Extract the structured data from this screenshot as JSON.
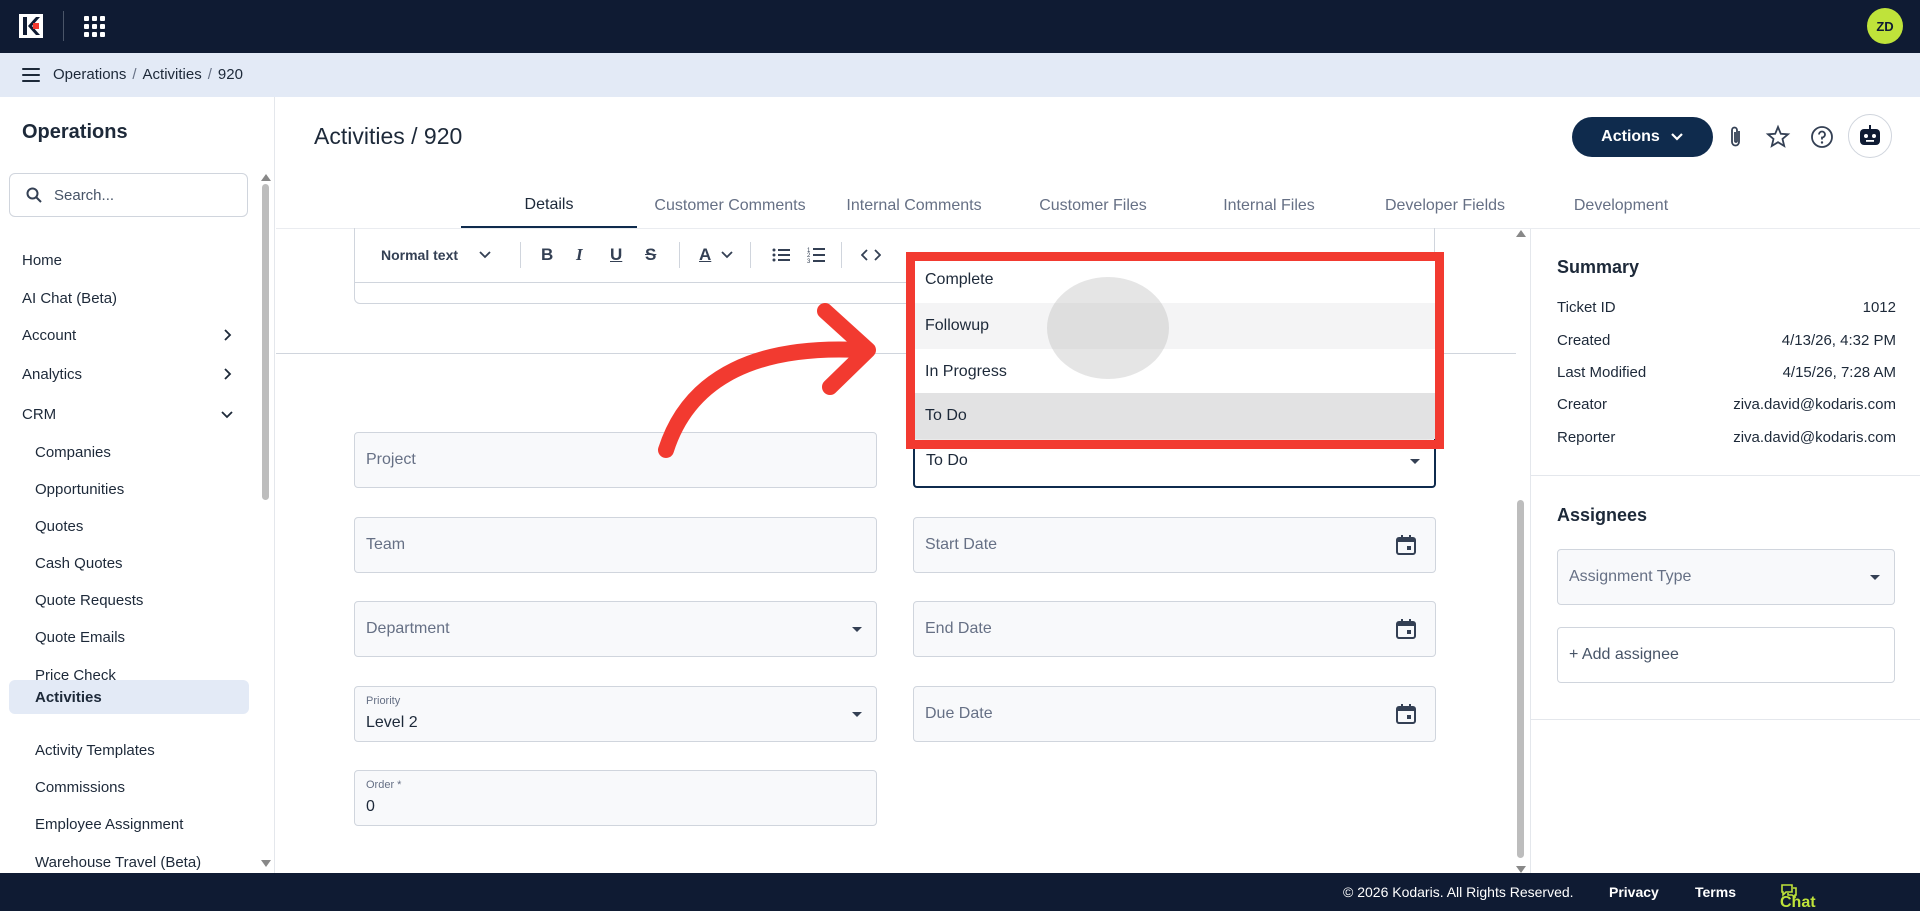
{
  "topbar": {
    "avatar_initials": "ZD"
  },
  "breadcrumb": {
    "items": [
      "Operations",
      "Activities",
      "920"
    ],
    "sep": "/"
  },
  "sidebar": {
    "title": "Operations",
    "search_placeholder": "Search...",
    "items": [
      {
        "label": "Home"
      },
      {
        "label": "AI Chat (Beta)"
      },
      {
        "label": "Account"
      },
      {
        "label": "Analytics"
      },
      {
        "label": "CRM"
      },
      {
        "label": "Companies"
      },
      {
        "label": "Opportunities"
      },
      {
        "label": "Quotes"
      },
      {
        "label": "Cash Quotes"
      },
      {
        "label": "Quote Requests"
      },
      {
        "label": "Quote Emails"
      },
      {
        "label": "Price Check"
      },
      {
        "label": "Activities"
      },
      {
        "label": "Activity Templates"
      },
      {
        "label": "Commissions"
      },
      {
        "label": "Employee Assignment"
      },
      {
        "label": "Warehouse Travel (Beta)"
      }
    ]
  },
  "header": {
    "title": "Activities / 920",
    "actions_label": "Actions"
  },
  "tabs": [
    "Details",
    "Customer Comments",
    "Internal Comments",
    "Customer Files",
    "Internal Files",
    "Developer Fields",
    "Development"
  ],
  "editor": {
    "format_label": "Normal text"
  },
  "form": {
    "project_placeholder": "Project",
    "status_value": "To Do",
    "team_placeholder": "Team",
    "start_date_placeholder": "Start Date",
    "department_placeholder": "Department",
    "end_date_placeholder": "End Date",
    "priority_label": "Priority",
    "priority_value": "Level 2",
    "due_date_placeholder": "Due Date",
    "order_label": "Order *",
    "order_value": "0"
  },
  "status_dropdown": {
    "options": [
      "Complete",
      "Followup",
      "In Progress",
      "To Do"
    ],
    "hovered": "Followup",
    "selected": "To Do"
  },
  "summary": {
    "title": "Summary",
    "rows": [
      {
        "key": "Ticket ID",
        "value": "1012"
      },
      {
        "key": "Created",
        "value": "4/13/26, 4:32 PM"
      },
      {
        "key": "Last Modified",
        "value": "4/15/26, 7:28 AM"
      },
      {
        "key": "Creator",
        "value": "ziva.david@kodaris.com"
      },
      {
        "key": "Reporter",
        "value": "ziva.david@kodaris.com"
      }
    ]
  },
  "assignees": {
    "title": "Assignees",
    "type_placeholder": "Assignment Type",
    "add_label": "+ Add assignee"
  },
  "footer": {
    "copyright": "© 2026 Kodaris. All Rights Reserved.",
    "privacy": "Privacy",
    "terms": "Terms",
    "chat": "Chat with us"
  },
  "colors": {
    "navy": "#0f1b33",
    "accent": "#bfe33a",
    "highlight": "#f23a30",
    "active_bg": "#e3eaf6"
  }
}
